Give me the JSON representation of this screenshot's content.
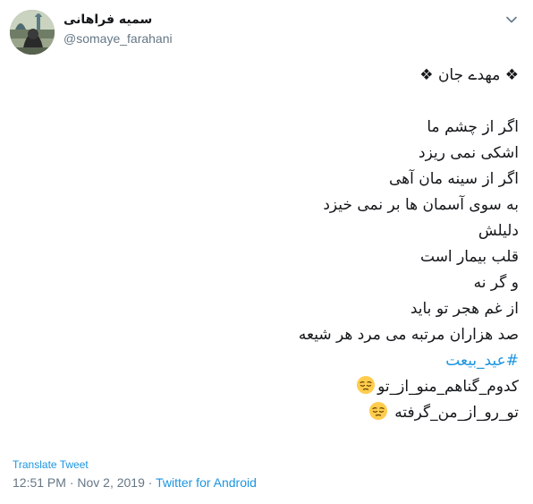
{
  "user": {
    "display_name": "سمیه فراهانی",
    "handle": "@somaye_farahani"
  },
  "tweet": {
    "heading": "❖ مهدے جان ❖",
    "lines": [
      "اگر از چشم ما",
      "اشکی نمی ریزد",
      "اگر از سینه مان آهی",
      "به سوی آسمان ها بر نمی خیزد",
      "دلیلش",
      "قلب بیمار است",
      "و گر نه",
      "از غم هجر تو باید",
      "صد هزاران مرتبه می مرد هر شیعه"
    ],
    "hashtag": "#عید_بیعت",
    "line_emoji_1": "کدوم_گناهم_منو_از_تو",
    "line_emoji_2": "تو_رو_از_من_گرفته",
    "emoji_name": "pensive-face-emoji"
  },
  "footer": {
    "translate_label": "Translate Tweet",
    "timestamp": "12:51 PM · Nov 2, 2019 · ",
    "source": "Twitter for Android"
  },
  "colors": {
    "link": "#1b95e0",
    "secondary_text": "#657786",
    "primary_text": "#14171a"
  },
  "icons": {
    "menu": "chevron-down-icon"
  }
}
